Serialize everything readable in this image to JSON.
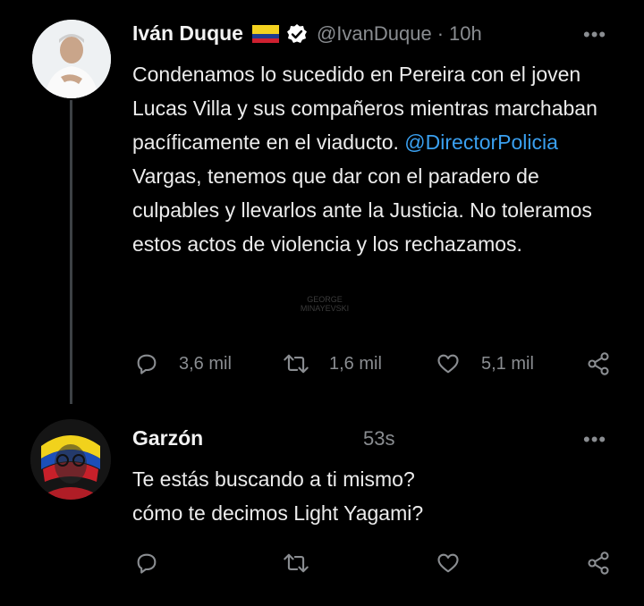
{
  "tweet1": {
    "display_name": "Iván Duque",
    "handle": "@IvanDuque",
    "separator": "·",
    "time": "10h",
    "more": "•••",
    "text_before_mention": "Condenamos lo sucedido en Pereira con el joven Lucas Villa y sus compañeros mientras marchaban pacíficamente en el viaducto. ",
    "mention": "@DirectorPolicia",
    "text_after_mention": " Vargas, tenemos que dar con el paradero de culpables y llevarlos ante la Justicia. No toleramos estos actos de violencia y los rechazamos.",
    "watermark": "GEORGE MINAYEVSKI",
    "reply_count": "3,6 mil",
    "retweet_count": "1,6 mil",
    "like_count": "5,1 mil",
    "flag_colors": [
      "#f4d21f",
      "#1f3c8f",
      "#cf2030"
    ],
    "verified_color": "#ffffff"
  },
  "tweet2": {
    "display_name": "Garzón",
    "time": "53s",
    "more": "•••",
    "line1": "Te estás buscando a ti mismo?",
    "line2": "cómo te decimos Light Yagami?"
  },
  "icons": {
    "reply": "reply-icon",
    "retweet": "retweet-icon",
    "like": "heart-icon",
    "share": "share-icon"
  }
}
